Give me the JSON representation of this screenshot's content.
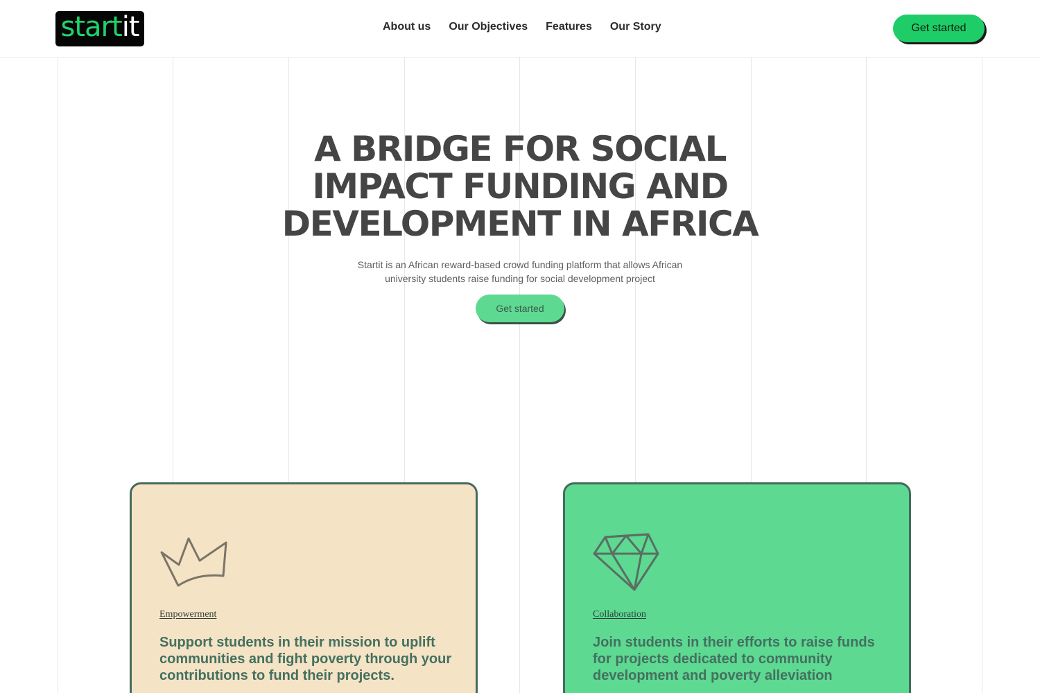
{
  "brand": {
    "logo_part1": "start",
    "logo_part2": "it"
  },
  "nav": {
    "items": [
      {
        "label": "About us"
      },
      {
        "label": "Our Objectives"
      },
      {
        "label": "Features"
      },
      {
        "label": "Our Story"
      }
    ],
    "cta_label": "Get started"
  },
  "hero": {
    "title_lines": [
      "A BRIDGE FOR SOCIAL",
      "IMPACT FUNDING AND",
      "DEVELOPMENT IN AFRICA"
    ],
    "subtitle_lines": [
      "Startit is an African reward-based crowd funding platform that allows African",
      "university students raise funding for social development project"
    ],
    "cta_label": "Get started"
  },
  "cards": [
    {
      "icon": "crown-icon",
      "tag": "Empowerment",
      "description": "Support students in their mission to uplift communities and fight poverty through your contributions to fund their projects."
    },
    {
      "icon": "diamond-icon",
      "tag": "Collaboration",
      "description": "Join students in their efforts to raise funds for projects dedicated to community development and poverty alleviation"
    }
  ],
  "colors": {
    "brand_green": "#1ecd67",
    "light_green": "#5dd992",
    "cream": "#f5e3c6",
    "card_border": "#466b5c"
  }
}
